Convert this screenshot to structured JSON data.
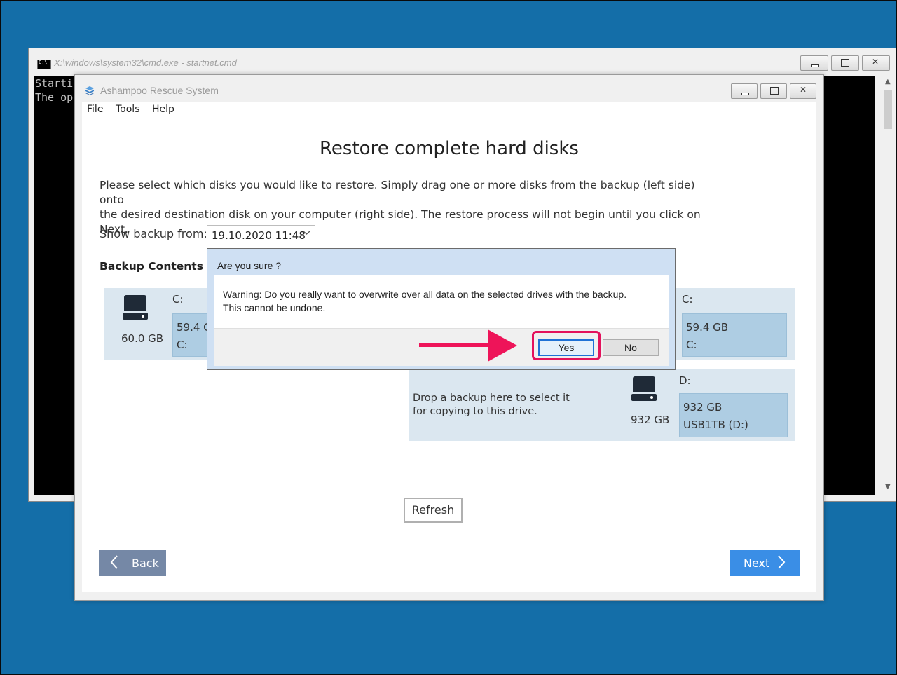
{
  "cmd_window": {
    "title": "X:\\windows\\system32\\cmd.exe - startnet.cmd",
    "lines": [
      "Starti",
      "The op"
    ]
  },
  "app": {
    "title": "Ashampoo Rescue System",
    "menu": {
      "file": "File",
      "tools": "Tools",
      "help": "Help"
    },
    "page_title": "Restore complete hard disks",
    "instructions_line1": "Please select which disks you would like to restore. Simply drag one or more disks from the backup (left side) onto",
    "instructions_line2": "the desired destination disk on your computer (right side). The restore process will not begin until you click on Next.",
    "show_backup_label": "Show backup from:",
    "backup_date": "19.10.2020 11:48",
    "backup_contents_label": "Backup Contents",
    "backup_disk": {
      "drive_letter": "C:",
      "size": "60.0 GB",
      "partition_size": "59.4 G",
      "partition_letter": "C:"
    },
    "dest_disk_1": {
      "drive_letter": "C:",
      "partition_size": "59.4 GB",
      "partition_letter": "C:"
    },
    "dest_disk_2": {
      "drop_text_line1": "Drop a backup here to select it",
      "drop_text_line2": "for copying to this drive.",
      "size": "932 GB",
      "drive_letter": "D:",
      "partition_size": "932 GB",
      "partition_label": "USB1TB (D:)"
    },
    "refresh_label": "Refresh",
    "back_label": "Back",
    "next_label": "Next"
  },
  "dialog": {
    "title": "Are you sure ?",
    "message_line1": "Warning: Do you really want to overwrite over all data on the selected drives with the backup.",
    "message_line2": "This cannot be undone.",
    "yes_label": "Yes",
    "no_label": "No"
  },
  "colors": {
    "desktop": "#146ea8",
    "panel": "#dbe7f0",
    "partition": "#aecde3",
    "next_button": "#3a8ee6",
    "back_button": "#7588a6",
    "annotation": "#ee1459"
  },
  "icons": {
    "window_controls": [
      "minimize-icon",
      "maximize-icon",
      "close-icon"
    ],
    "drive": "hard-drive-icon",
    "back": "chevron-left-icon",
    "next": "chevron-right-icon"
  }
}
